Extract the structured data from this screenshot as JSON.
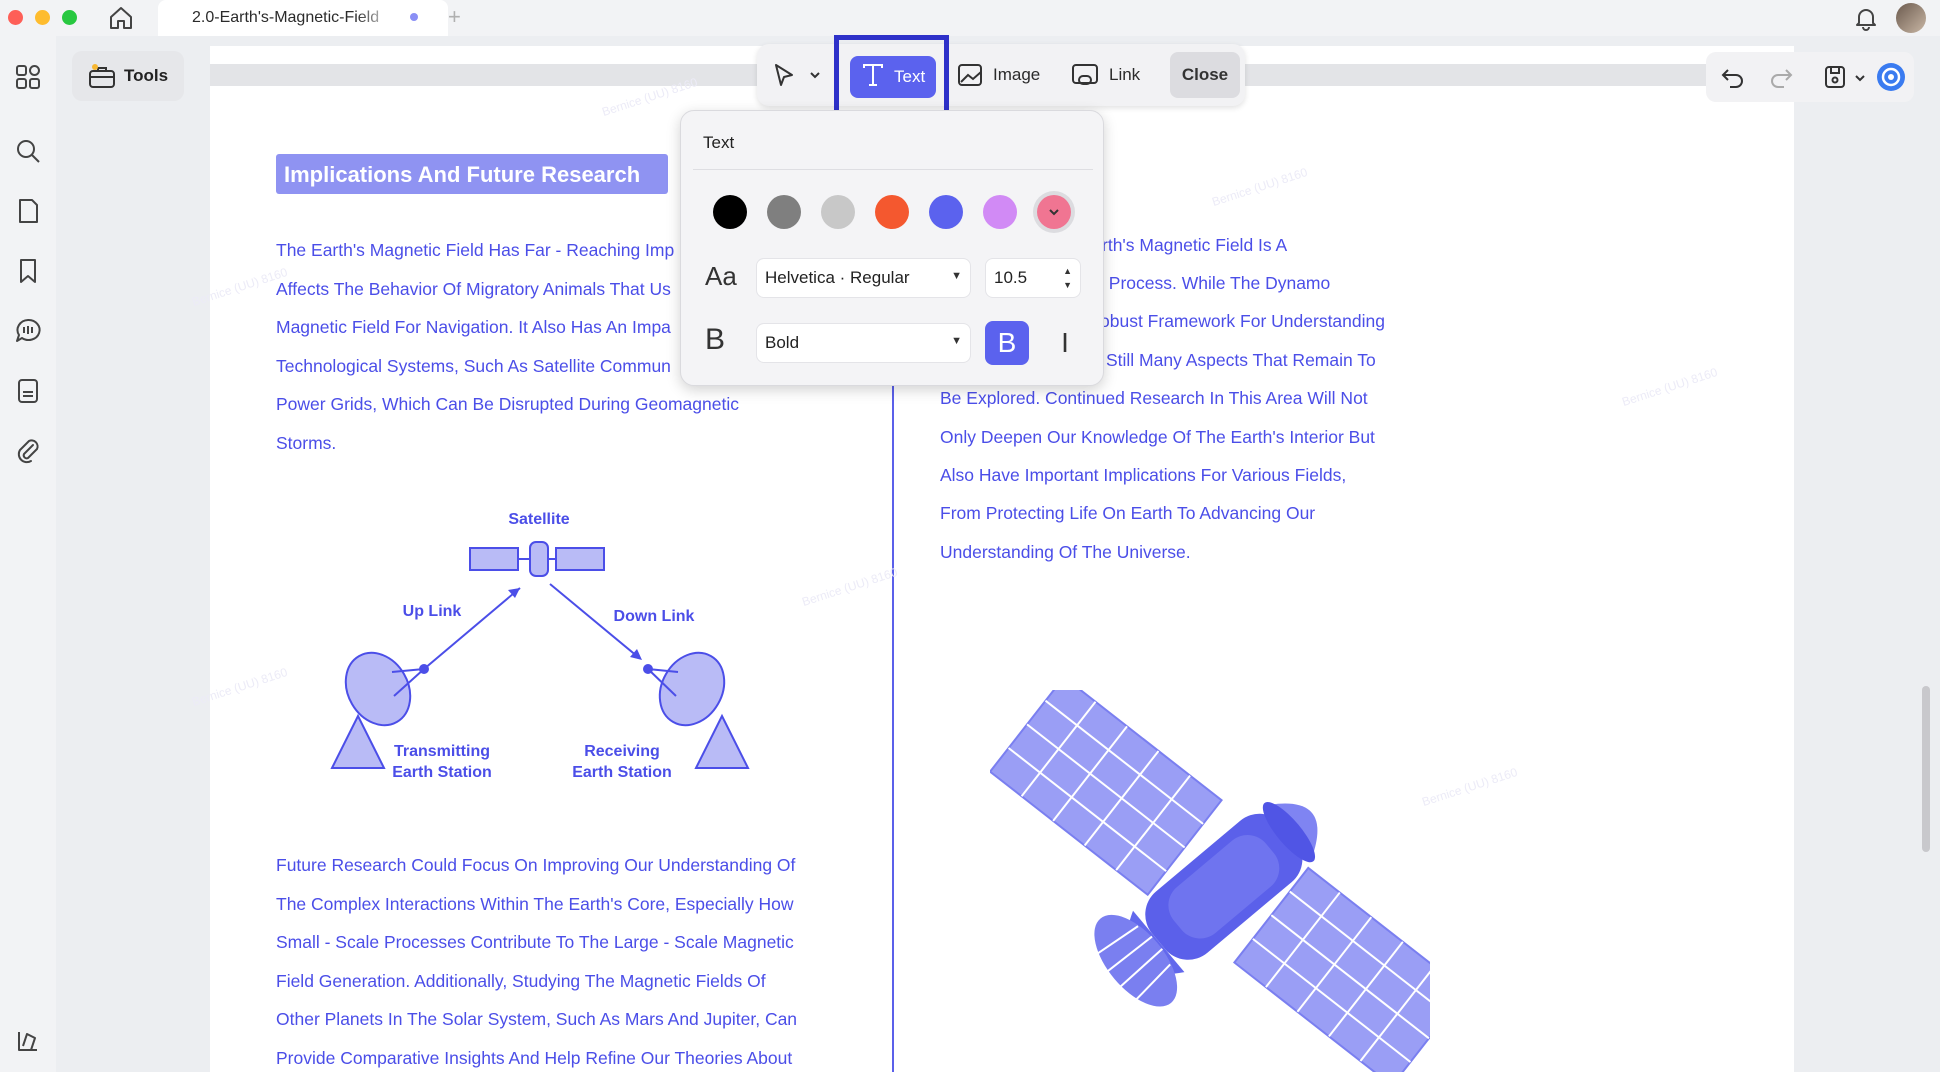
{
  "window": {
    "tab_title": "2.0-Earth's-Magnetic-Field",
    "new_tab": "+"
  },
  "toolbar": {
    "tools_label": "Tools",
    "text_label": "Text",
    "image_label": "Image",
    "link_label": "Link",
    "close_label": "Close"
  },
  "text_popup": {
    "title": "Text",
    "colors": [
      "#000000",
      "#7f7f7f",
      "#c8c8c8",
      "#f4582f",
      "#5b62ee",
      "#d18af5",
      "#f07592"
    ],
    "font_icon": "Aa",
    "font_family": "Helvetica · Regular",
    "font_size": "10.5",
    "weight_icon": "B",
    "font_weight": "Bold",
    "bold_toggle": "B",
    "italic_toggle": "I"
  },
  "document": {
    "heading": "Implications And Future Research",
    "left_para1": [
      "The Earth's Magnetic Field Has Far - Reaching Imp",
      "Affects The Behavior Of Migratory Animals That Us",
      "Magnetic Field For Navigation. It Also Has An Impa",
      "Technological Systems, Such As Satellite Commun",
      "Power Grids, Which Can Be Disrupted During Geomagnetic",
      "Storms."
    ],
    "right_para1": [
      "e Earth's Magnetic Field Is A",
      "ating Process. While The Dynamo",
      "obust Framework For Understanding",
      "Still Many Aspects That Remain To",
      "Be Explored. Continued Research In This Area Will Not",
      "Only Deepen Our Knowledge Of The Earth's Interior But",
      "Also Have Important Implications For Various Fields,",
      "From Protecting Life On Earth To Advancing Our",
      "Understanding Of The Universe."
    ],
    "left_para2": [
      "Future Research Could Focus On Improving Our Understanding Of",
      "The Complex Interactions Within The Earth's Core, Especially How",
      "Small - Scale Processes Contribute To The Large - Scale Magnetic",
      "Field Generation. Additionally, Studying The Magnetic Fields Of",
      "Other Planets In The Solar System, Such As Mars And Jupiter, Can",
      "Provide Comparative Insights And Help Refine Our Theories About"
    ],
    "diagram": {
      "satellite": "Satellite",
      "uplink": "Up Link",
      "downlink": "Down Link",
      "transmitting_1": "Transmitting",
      "transmitting_2": "Earth Station",
      "receiving_1": "Receiving",
      "receiving_2": "Earth Station"
    }
  },
  "colors": {
    "accent": "#5b62ee",
    "doc_text": "#4b4ee8",
    "heading_bg": "#8f93f2"
  }
}
